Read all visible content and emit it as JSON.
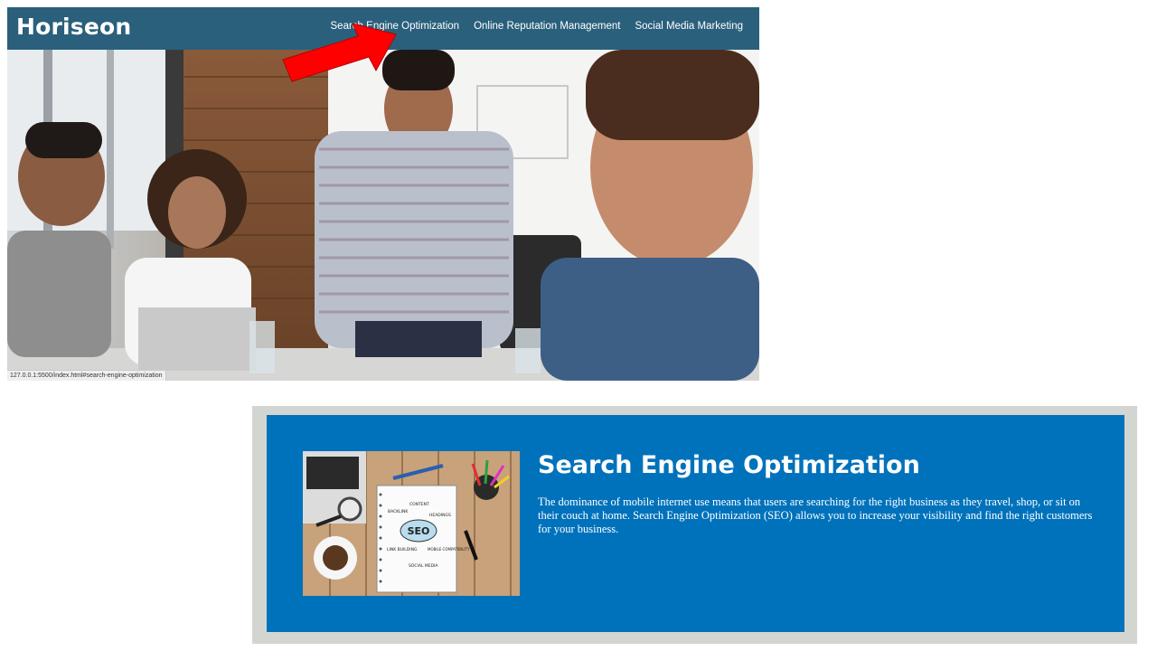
{
  "header": {
    "logo": "Horiseon",
    "bg_color": "#2a607c",
    "nav": [
      {
        "label": "Search Engine Optimization"
      },
      {
        "label": "Online Reputation Management"
      },
      {
        "label": "Social Media Marketing"
      }
    ]
  },
  "hero": {
    "icon": "team-meeting-photo"
  },
  "annotation": {
    "icon": "red-arrow-icon",
    "color": "#ff0000"
  },
  "status_bar": {
    "url": "127.0.0.1:5500/index.html#search-engine-optimization"
  },
  "seo_section": {
    "title": "Search Engine Optimization",
    "text": "The dominance of mobile internet use means that users are searching for the right business as they travel, shop, or sit on their couch at home. Search Engine Optimization (SEO) allows you to increase your visibility and find the right customers for your business.",
    "bg_color": "#0072bb",
    "image": {
      "icon": "seo-notebook-photo",
      "labels": [
        "CONTENT",
        "BACKLINK",
        "HEADINGS",
        "SEO",
        "LINK BUILDING",
        "MOBILE COMPATIBILITY",
        "SOCIAL MEDIA"
      ]
    }
  }
}
